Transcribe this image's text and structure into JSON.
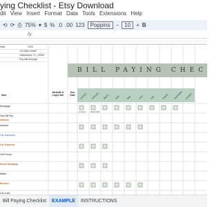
{
  "window": {
    "title": "ying Checklist - Etsy Download"
  },
  "menu": [
    "dit",
    "View",
    "Insert",
    "Format",
    "Data",
    "Tools",
    "Extensions",
    "Help"
  ],
  "toolbar": {
    "zoom": "75%",
    "currency": "$",
    "percent": "%",
    "decimals": ".0",
    "decimals2": ".00",
    "number_format": "123",
    "font": "Poppins",
    "font_size": "10"
  },
  "sheet": {
    "banner": "BILL PAYING CHECKLIST",
    "info": [
      {
        "label": "Date",
        "value": "2025"
      },
      {
        "label": "",
        "value": "123 Main Street"
      },
      {
        "label": "",
        "value": "Yellowstone, FL, 00000"
      },
      {
        "label": "",
        "value": "Pay bills through"
      }
    ],
    "left_labels": [
      "Item",
      "Mortgage",
      "Gas Bill Pay",
      "Utilities",
      "Internet",
      "Car Insurance",
      "Car Payment",
      "Cell Phone",
      "Home Mortgage",
      "Water",
      "Electric",
      "Car Loan"
    ],
    "website_heading": "Website & Login Info",
    "due_heading": "Due Date",
    "months": [
      "January",
      "February",
      "March",
      "April",
      "May",
      "June",
      "July",
      "August",
      "September",
      "October"
    ],
    "amount_label": "Amount",
    "date_paid_label": "Date Paid"
  },
  "sheet_tabs": [
    "Bill Paying Checklist",
    "EXAMPLE",
    "INSTRUCTIONS"
  ],
  "colors": {
    "banner": "#b7c4b5",
    "month_header": "#b7d0c1",
    "accent": "#0b57d0",
    "orange": "#c56a23"
  }
}
